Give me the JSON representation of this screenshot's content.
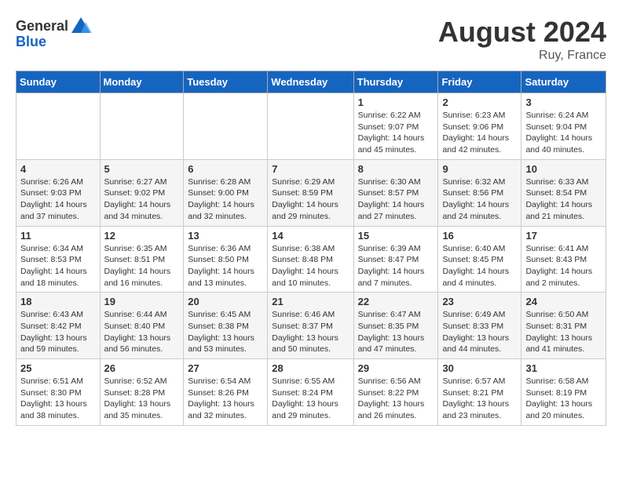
{
  "header": {
    "logo_general": "General",
    "logo_blue": "Blue",
    "month_year": "August 2024",
    "location": "Ruy, France"
  },
  "days_of_week": [
    "Sunday",
    "Monday",
    "Tuesday",
    "Wednesday",
    "Thursday",
    "Friday",
    "Saturday"
  ],
  "weeks": [
    [
      {
        "day": "",
        "info": ""
      },
      {
        "day": "",
        "info": ""
      },
      {
        "day": "",
        "info": ""
      },
      {
        "day": "",
        "info": ""
      },
      {
        "day": "1",
        "info": "Sunrise: 6:22 AM\nSunset: 9:07 PM\nDaylight: 14 hours and 45 minutes."
      },
      {
        "day": "2",
        "info": "Sunrise: 6:23 AM\nSunset: 9:06 PM\nDaylight: 14 hours and 42 minutes."
      },
      {
        "day": "3",
        "info": "Sunrise: 6:24 AM\nSunset: 9:04 PM\nDaylight: 14 hours and 40 minutes."
      }
    ],
    [
      {
        "day": "4",
        "info": "Sunrise: 6:26 AM\nSunset: 9:03 PM\nDaylight: 14 hours and 37 minutes."
      },
      {
        "day": "5",
        "info": "Sunrise: 6:27 AM\nSunset: 9:02 PM\nDaylight: 14 hours and 34 minutes."
      },
      {
        "day": "6",
        "info": "Sunrise: 6:28 AM\nSunset: 9:00 PM\nDaylight: 14 hours and 32 minutes."
      },
      {
        "day": "7",
        "info": "Sunrise: 6:29 AM\nSunset: 8:59 PM\nDaylight: 14 hours and 29 minutes."
      },
      {
        "day": "8",
        "info": "Sunrise: 6:30 AM\nSunset: 8:57 PM\nDaylight: 14 hours and 27 minutes."
      },
      {
        "day": "9",
        "info": "Sunrise: 6:32 AM\nSunset: 8:56 PM\nDaylight: 14 hours and 24 minutes."
      },
      {
        "day": "10",
        "info": "Sunrise: 6:33 AM\nSunset: 8:54 PM\nDaylight: 14 hours and 21 minutes."
      }
    ],
    [
      {
        "day": "11",
        "info": "Sunrise: 6:34 AM\nSunset: 8:53 PM\nDaylight: 14 hours and 18 minutes."
      },
      {
        "day": "12",
        "info": "Sunrise: 6:35 AM\nSunset: 8:51 PM\nDaylight: 14 hours and 16 minutes."
      },
      {
        "day": "13",
        "info": "Sunrise: 6:36 AM\nSunset: 8:50 PM\nDaylight: 14 hours and 13 minutes."
      },
      {
        "day": "14",
        "info": "Sunrise: 6:38 AM\nSunset: 8:48 PM\nDaylight: 14 hours and 10 minutes."
      },
      {
        "day": "15",
        "info": "Sunrise: 6:39 AM\nSunset: 8:47 PM\nDaylight: 14 hours and 7 minutes."
      },
      {
        "day": "16",
        "info": "Sunrise: 6:40 AM\nSunset: 8:45 PM\nDaylight: 14 hours and 4 minutes."
      },
      {
        "day": "17",
        "info": "Sunrise: 6:41 AM\nSunset: 8:43 PM\nDaylight: 14 hours and 2 minutes."
      }
    ],
    [
      {
        "day": "18",
        "info": "Sunrise: 6:43 AM\nSunset: 8:42 PM\nDaylight: 13 hours and 59 minutes."
      },
      {
        "day": "19",
        "info": "Sunrise: 6:44 AM\nSunset: 8:40 PM\nDaylight: 13 hours and 56 minutes."
      },
      {
        "day": "20",
        "info": "Sunrise: 6:45 AM\nSunset: 8:38 PM\nDaylight: 13 hours and 53 minutes."
      },
      {
        "day": "21",
        "info": "Sunrise: 6:46 AM\nSunset: 8:37 PM\nDaylight: 13 hours and 50 minutes."
      },
      {
        "day": "22",
        "info": "Sunrise: 6:47 AM\nSunset: 8:35 PM\nDaylight: 13 hours and 47 minutes."
      },
      {
        "day": "23",
        "info": "Sunrise: 6:49 AM\nSunset: 8:33 PM\nDaylight: 13 hours and 44 minutes."
      },
      {
        "day": "24",
        "info": "Sunrise: 6:50 AM\nSunset: 8:31 PM\nDaylight: 13 hours and 41 minutes."
      }
    ],
    [
      {
        "day": "25",
        "info": "Sunrise: 6:51 AM\nSunset: 8:30 PM\nDaylight: 13 hours and 38 minutes."
      },
      {
        "day": "26",
        "info": "Sunrise: 6:52 AM\nSunset: 8:28 PM\nDaylight: 13 hours and 35 minutes."
      },
      {
        "day": "27",
        "info": "Sunrise: 6:54 AM\nSunset: 8:26 PM\nDaylight: 13 hours and 32 minutes."
      },
      {
        "day": "28",
        "info": "Sunrise: 6:55 AM\nSunset: 8:24 PM\nDaylight: 13 hours and 29 minutes."
      },
      {
        "day": "29",
        "info": "Sunrise: 6:56 AM\nSunset: 8:22 PM\nDaylight: 13 hours and 26 minutes."
      },
      {
        "day": "30",
        "info": "Sunrise: 6:57 AM\nSunset: 8:21 PM\nDaylight: 13 hours and 23 minutes."
      },
      {
        "day": "31",
        "info": "Sunrise: 6:58 AM\nSunset: 8:19 PM\nDaylight: 13 hours and 20 minutes."
      }
    ]
  ]
}
